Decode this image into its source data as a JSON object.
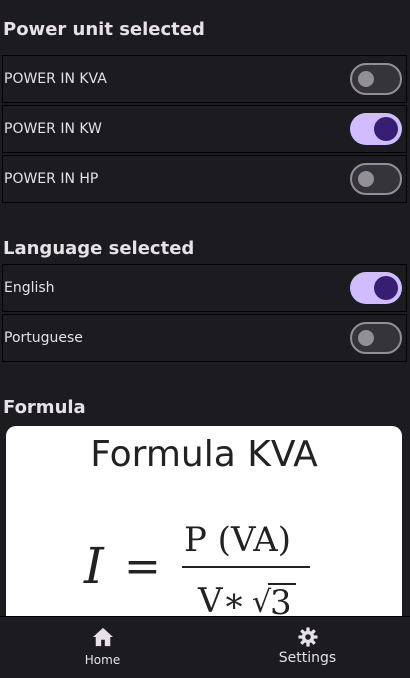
{
  "sections": {
    "power_title": "Power unit selected",
    "language_title": "Language selected",
    "formula_title": "Formula"
  },
  "power_units": [
    {
      "label": "POWER IN KVA",
      "checked": false
    },
    {
      "label": "POWER IN KW",
      "checked": true
    },
    {
      "label": "POWER IN HP",
      "checked": false
    }
  ],
  "languages": [
    {
      "label": "English",
      "checked": true
    },
    {
      "label": "Portuguese",
      "checked": false
    }
  ],
  "formula": {
    "title": "Formula KVA",
    "lhs": "I",
    "equals": "=",
    "numerator": "P (VA)",
    "denominator_prefix": "V∗",
    "sqrt_symbol": "√",
    "sqrt_value": "3"
  },
  "nav": {
    "home_label": "Home",
    "settings_label": "Settings",
    "home_icon": "home-icon",
    "settings_icon": "gear-icon"
  },
  "colors": {
    "background": "#1c1b1f",
    "switch_on_track": "#d0bcff",
    "switch_on_thumb": "#381e72",
    "switch_off_outline": "#938f99"
  }
}
